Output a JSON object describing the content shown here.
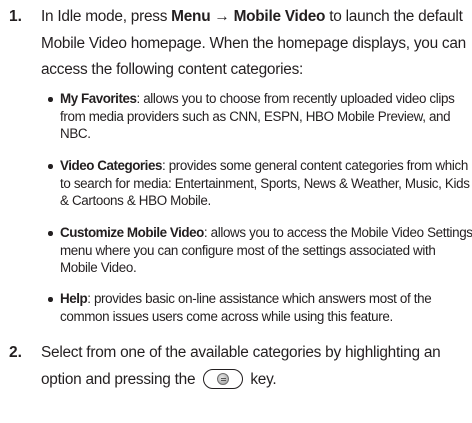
{
  "steps": [
    {
      "number": "1.",
      "intro": "In Idle mode, press ",
      "menu_label": "Menu",
      "arrow": " → ",
      "mobile_video_label": "Mobile Video",
      "rest": " to launch the default Mobile Video homepage. When the homepage displays, you can access the following content categories:",
      "bullets": [
        {
          "term": "My Favorites",
          "description": ": allows you to choose from recently uploaded video clips from media providers such as CNN, ESPN, HBO Mobile Preview, and NBC."
        },
        {
          "term": "Video Categories",
          "description": ": provides some general content categories from which to search for media: Entertainment, Sports, News & Weather, Music, Kids & Cartoons & HBO Mobile."
        },
        {
          "term": "Customize Mobile Video",
          "description": ": allows you to access the Mobile Video Settings menu where you can configure most of the settings associated with Mobile Video."
        },
        {
          "term": "Help",
          "description": ": provides basic on-line assistance which answers most of the common issues users come across while using this feature."
        }
      ]
    },
    {
      "number": "2.",
      "text_before_key": "Select from one of the available categories by highlighting an option and pressing the",
      "key_icon": "ok-select-key-icon",
      "text_after_key": "key."
    }
  ]
}
